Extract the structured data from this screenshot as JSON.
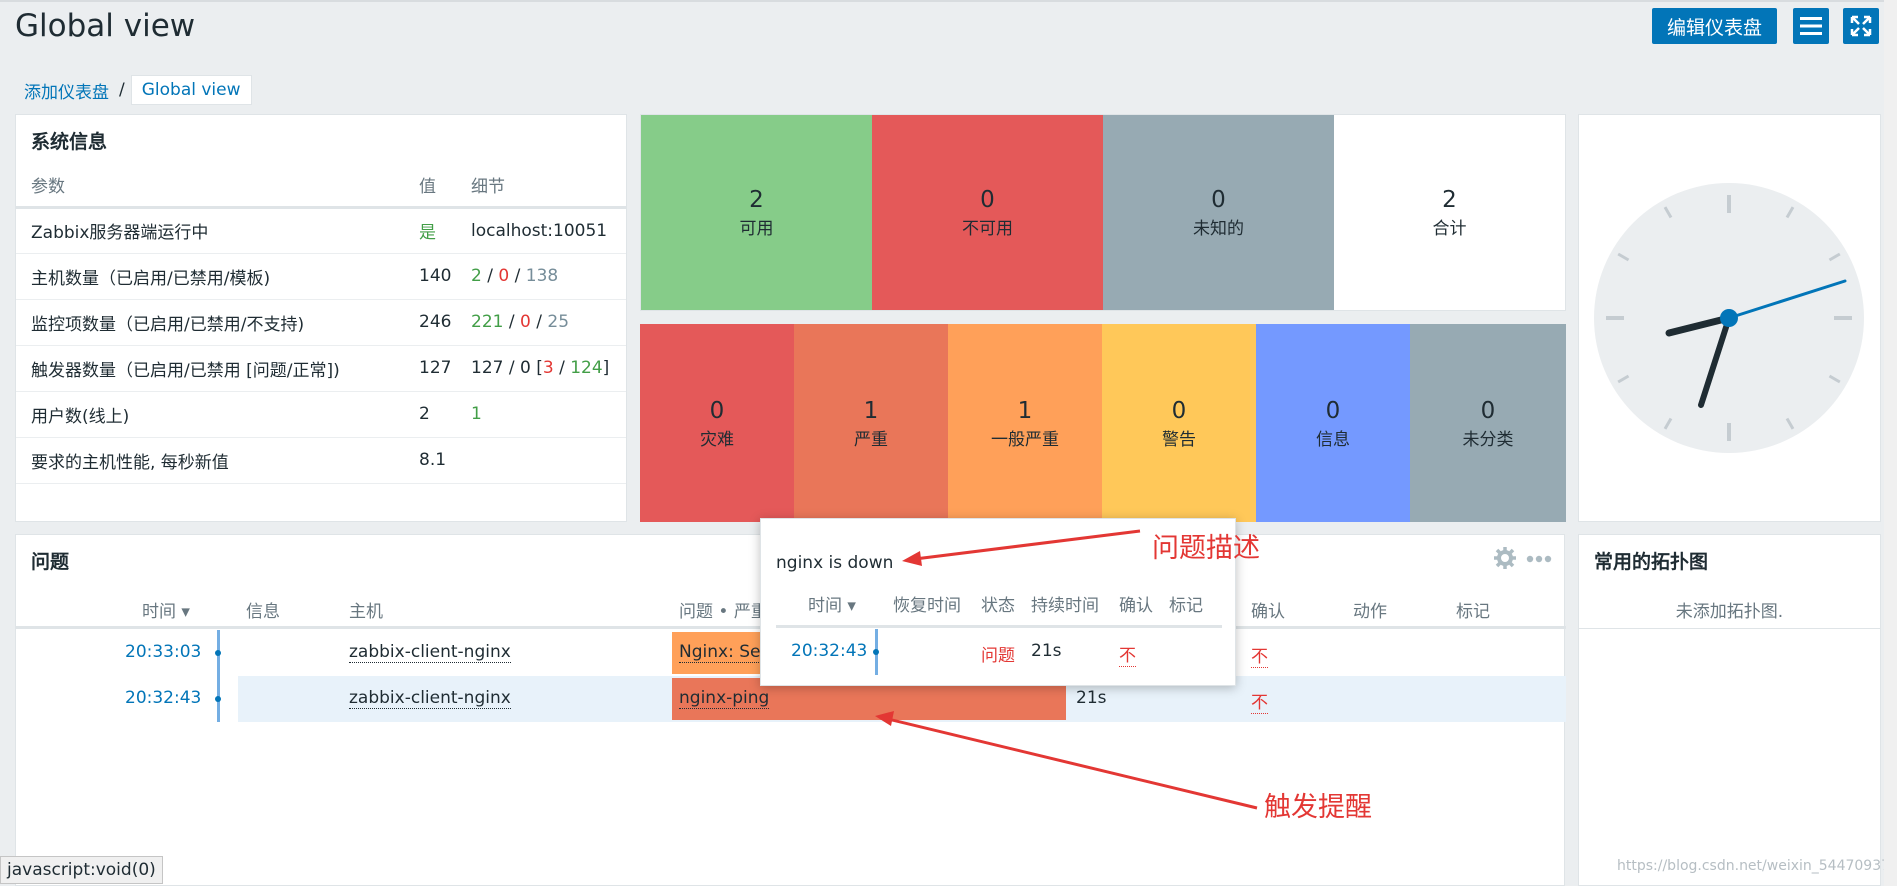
{
  "header": {
    "title": "Global view",
    "edit_button": "编辑仪表盘",
    "menu_icon": "menu-icon",
    "fullscreen_icon": "fullscreen-icon"
  },
  "breadcrumb": {
    "parent": "添加仪表盘",
    "separator": "/",
    "current": "Global view"
  },
  "system_info": {
    "title": "系统信息",
    "headers": [
      "参数",
      "值",
      "细节"
    ],
    "rows": [
      {
        "param": "Zabbix服务器端运行中",
        "value": "是",
        "detail": "localhost:10051"
      },
      {
        "param": "主机数量（已启用/已禁用/模板)",
        "value": "140",
        "d1": "2",
        "s1": " / ",
        "d2": "0",
        "s2": " / ",
        "d3": "138"
      },
      {
        "param": "监控项数量（已启用/已禁用/不支持)",
        "value": "246",
        "d1": "221",
        "s1": " / ",
        "d2": "0",
        "s2": " / ",
        "d3": "25"
      },
      {
        "param": "触发器数量（已启用/已禁用 [问题/正常])",
        "value": "127",
        "d0": "127 / 0 [",
        "d1": "3",
        "s1": " / ",
        "d2": "124",
        "s2": "]"
      },
      {
        "param": "用户数(线上)",
        "value": "2",
        "detail": "1"
      },
      {
        "param": "要求的主机性能, 每秒新值",
        "value": "8.1",
        "detail": ""
      }
    ]
  },
  "host_availability": [
    {
      "count": "2",
      "label": "可用",
      "color": "#86cc89"
    },
    {
      "count": "0",
      "label": "不可用",
      "color": "#e45959"
    },
    {
      "count": "0",
      "label": "未知的",
      "color": "#97aab3"
    },
    {
      "count": "2",
      "label": "合计",
      "color": "#ffffff"
    }
  ],
  "severity": [
    {
      "count": "0",
      "label": "灾难",
      "color": "#e45959"
    },
    {
      "count": "1",
      "label": "严重",
      "color": "#e97659"
    },
    {
      "count": "1",
      "label": "一般严重",
      "color": "#ffa059"
    },
    {
      "count": "0",
      "label": "警告",
      "color": "#ffc859"
    },
    {
      "count": "0",
      "label": "信息",
      "color": "#7499ff"
    },
    {
      "count": "0",
      "label": "未分类",
      "color": "#97aab3"
    }
  ],
  "problems": {
    "title": "问题",
    "gear_icon": "gear-icon",
    "more_icon": "more-icon",
    "headers": {
      "time": "时间 ▾",
      "info": "信息",
      "host": "主机",
      "problem": "问题 • 严重",
      "ack": "确认",
      "actions": "动作",
      "tags": "标记"
    },
    "rows": [
      {
        "time": "20:33:03",
        "host": "zabbix-client-nginx",
        "problem": "Nginx: Ser",
        "duration": "",
        "ack": "不",
        "color": "#ffa059"
      },
      {
        "time": "20:32:43",
        "host": "zabbix-client-nginx",
        "problem": "nginx-ping",
        "duration": "21s",
        "ack": "不",
        "color": "#e97659"
      }
    ]
  },
  "popup": {
    "description": "nginx is down",
    "headers": {
      "time": "时间 ▾",
      "recovery": "恢复时间",
      "status": "状态",
      "duration": "持续时间",
      "ack": "确认",
      "tags": "标记"
    },
    "row": {
      "time": "20:32:43",
      "status": "问题",
      "duration": "21s",
      "ack": "不"
    }
  },
  "topology": {
    "title": "常用的拓扑图",
    "empty": "未添加拓扑图."
  },
  "annotations": {
    "desc": "问题描述",
    "trigger": "触发提醒"
  },
  "status_bar": "javascript:void(0)",
  "watermark": "https://blog.csdn.net/weixin_54470937"
}
